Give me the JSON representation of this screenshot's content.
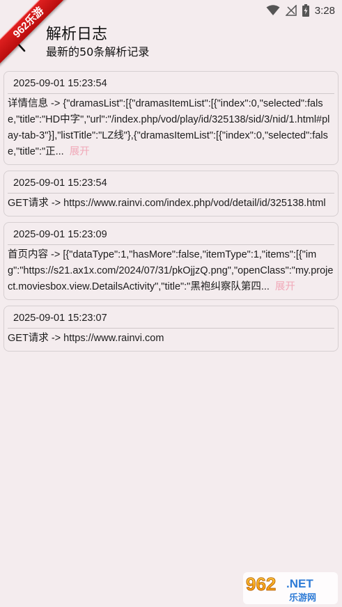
{
  "status_bar": {
    "time": "3:28"
  },
  "watermark": {
    "ribbon_text": "962乐游",
    "logo_text": "962.NET",
    "logo_sub": "乐游网"
  },
  "header": {
    "title": "解析日志",
    "subtitle": "最新的50条解析记录",
    "back_icon": "chevron-left-icon"
  },
  "logs": [
    {
      "time": "2025-09-01 15:23:54",
      "body": "详情信息 -> {\"dramasList\":[{\"dramasItemList\":[{\"index\":0,\"selected\":false,\"title\":\"HD中字\",\"url\":\"/index.php/vod/play/id/325138/sid/3/nid/1.html#play-tab-3\"}],\"listTitle\":\"LZ线\"},{\"dramasItemList\":[{\"index\":0,\"selected\":false,\"title\":\"正...",
      "expand": "展开"
    },
    {
      "time": "2025-09-01 15:23:54",
      "body": "GET请求 -> https://www.rainvi.com/index.php/vod/detail/id/325138.html",
      "expand": ""
    },
    {
      "time": "2025-09-01 15:23:09",
      "body": "首页内容 -> [{\"dataType\":1,\"hasMore\":false,\"itemType\":1,\"items\":[{\"img\":\"https://s21.ax1x.com/2024/07/31/pkOjjzQ.png\",\"openClass\":\"my.project.moviesbox.view.DetailsActivity\",\"title\":\"黑袍纠察队第四...",
      "expand": "展开"
    },
    {
      "time": "2025-09-01 15:23:07",
      "body": "GET请求 -> https://www.rainvi.com",
      "expand": ""
    }
  ],
  "colors": {
    "background": "#f4ecee",
    "expand": "#f1a8b8",
    "border": "#d6cfd1"
  }
}
